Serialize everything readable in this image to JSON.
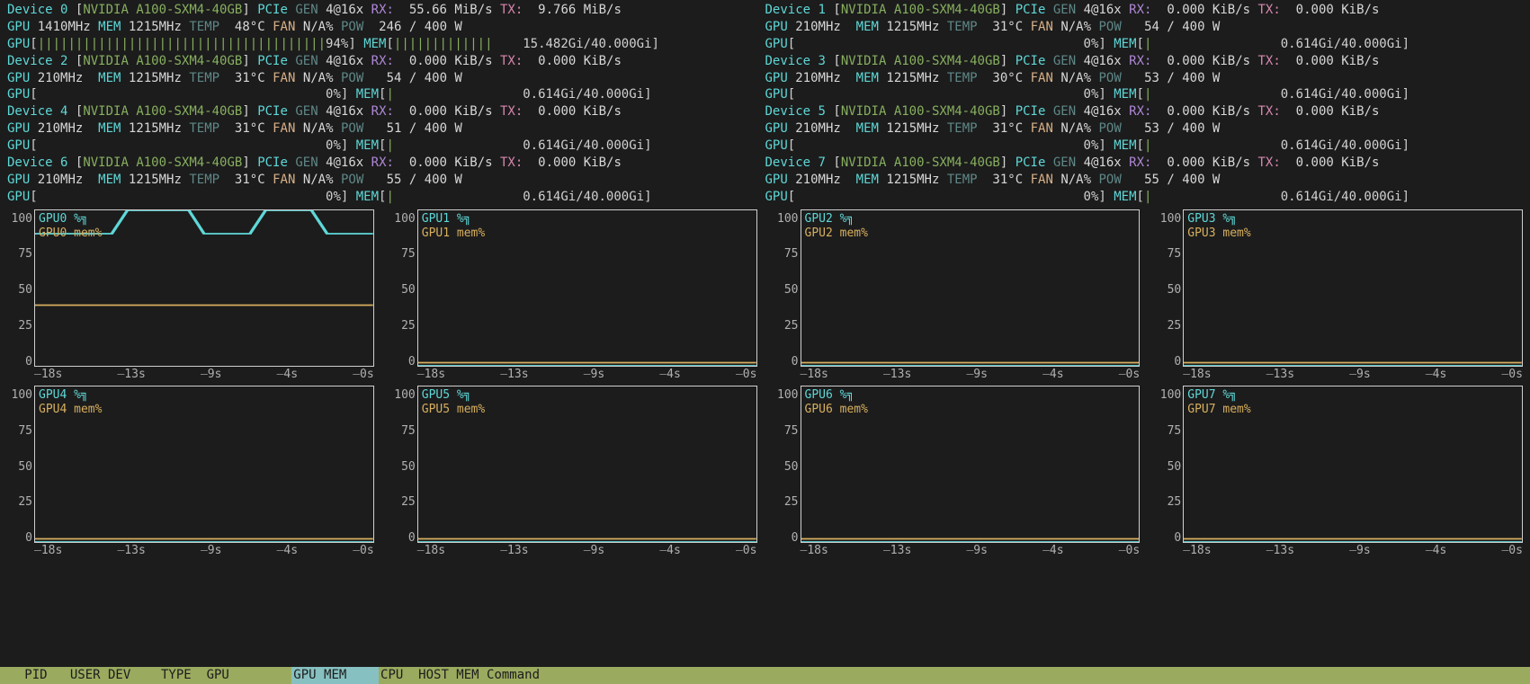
{
  "devices": [
    {
      "idx": 0,
      "model": "NVIDIA A100-SXM4-40GB",
      "pcie_gen": "4@16x",
      "rx": "55.66 MiB/s",
      "tx": "9.766 MiB/s",
      "gpu_clk": "1410MHz",
      "mem_clk": "1215MHz",
      "temp": "48°C",
      "fan": "N/A%",
      "pow": "246 / 400 W",
      "gpu_util": 94,
      "mem_used": "15.482Gi",
      "mem_total": "40.000Gi",
      "mem_pct": 39
    },
    {
      "idx": 1,
      "model": "NVIDIA A100-SXM4-40GB",
      "pcie_gen": "4@16x",
      "rx": "0.000 KiB/s",
      "tx": "0.000 KiB/s",
      "gpu_clk": "210MHz",
      "mem_clk": "1215MHz",
      "temp": "31°C",
      "fan": "N/A%",
      "pow": "54 / 400 W",
      "gpu_util": 0,
      "mem_used": "0.614Gi",
      "mem_total": "40.000Gi",
      "mem_pct": 2
    },
    {
      "idx": 2,
      "model": "NVIDIA A100-SXM4-40GB",
      "pcie_gen": "4@16x",
      "rx": "0.000 KiB/s",
      "tx": "0.000 KiB/s",
      "gpu_clk": "210MHz",
      "mem_clk": "1215MHz",
      "temp": "31°C",
      "fan": "N/A%",
      "pow": "54 / 400 W",
      "gpu_util": 0,
      "mem_used": "0.614Gi",
      "mem_total": "40.000Gi",
      "mem_pct": 2
    },
    {
      "idx": 3,
      "model": "NVIDIA A100-SXM4-40GB",
      "pcie_gen": "4@16x",
      "rx": "0.000 KiB/s",
      "tx": "0.000 KiB/s",
      "gpu_clk": "210MHz",
      "mem_clk": "1215MHz",
      "temp": "30°C",
      "fan": "N/A%",
      "pow": "53 / 400 W",
      "gpu_util": 0,
      "mem_used": "0.614Gi",
      "mem_total": "40.000Gi",
      "mem_pct": 2
    },
    {
      "idx": 4,
      "model": "NVIDIA A100-SXM4-40GB",
      "pcie_gen": "4@16x",
      "rx": "0.000 KiB/s",
      "tx": "0.000 KiB/s",
      "gpu_clk": "210MHz",
      "mem_clk": "1215MHz",
      "temp": "31°C",
      "fan": "N/A%",
      "pow": "51 / 400 W",
      "gpu_util": 0,
      "mem_used": "0.614Gi",
      "mem_total": "40.000Gi",
      "mem_pct": 2
    },
    {
      "idx": 5,
      "model": "NVIDIA A100-SXM4-40GB",
      "pcie_gen": "4@16x",
      "rx": "0.000 KiB/s",
      "tx": "0.000 KiB/s",
      "gpu_clk": "210MHz",
      "mem_clk": "1215MHz",
      "temp": "31°C",
      "fan": "N/A%",
      "pow": "53 / 400 W",
      "gpu_util": 0,
      "mem_used": "0.614Gi",
      "mem_total": "40.000Gi",
      "mem_pct": 2
    },
    {
      "idx": 6,
      "model": "NVIDIA A100-SXM4-40GB",
      "pcie_gen": "4@16x",
      "rx": "0.000 KiB/s",
      "tx": "0.000 KiB/s",
      "gpu_clk": "210MHz",
      "mem_clk": "1215MHz",
      "temp": "31°C",
      "fan": "N/A%",
      "pow": "55 / 400 W",
      "gpu_util": 0,
      "mem_used": "0.614Gi",
      "mem_total": "40.000Gi",
      "mem_pct": 2
    },
    {
      "idx": 7,
      "model": "NVIDIA A100-SXM4-40GB",
      "pcie_gen": "4@16x",
      "rx": "0.000 KiB/s",
      "tx": "0.000 KiB/s",
      "gpu_clk": "210MHz",
      "mem_clk": "1215MHz",
      "temp": "31°C",
      "fan": "N/A%",
      "pow": "55 / 400 W",
      "gpu_util": 0,
      "mem_used": "0.614Gi",
      "mem_total": "40.000Gi",
      "mem_pct": 2
    }
  ],
  "labels": {
    "device": "Device",
    "pcie": "PCIe",
    "gen": "GEN",
    "rx": "RX:",
    "tx": "TX:",
    "gpu": "GPU",
    "mem": "MEM",
    "temp": "TEMP",
    "fan": "FAN",
    "pow": "POW"
  },
  "chart_axes": {
    "y": [
      "100",
      "75",
      "50",
      "25",
      "0"
    ],
    "x": [
      "18s",
      "13s",
      "9s",
      "4s",
      "0s"
    ]
  },
  "chart_data": [
    {
      "name": "GPU0",
      "legend_util": "GPU0 %",
      "legend_mem": "GPU0 mem%",
      "util_series": [
        85,
        85,
        85,
        85,
        85,
        85,
        100,
        100,
        100,
        100,
        100,
        85,
        85,
        85,
        85,
        100,
        100,
        100,
        100,
        85,
        85,
        85,
        85
      ],
      "mem_series": [
        39,
        39,
        39,
        39,
        39,
        39,
        39,
        39,
        39,
        39,
        39,
        39,
        39,
        39,
        39,
        39,
        39,
        39,
        39,
        39,
        39,
        39,
        39
      ]
    },
    {
      "name": "GPU1",
      "legend_util": "GPU1 %",
      "legend_mem": "GPU1 mem%",
      "util_series": [
        0,
        0,
        0,
        0,
        0,
        0,
        0,
        0,
        0,
        0,
        0,
        0,
        0,
        0,
        0,
        0,
        0,
        0,
        0,
        0,
        0,
        0,
        0
      ],
      "mem_series": [
        2,
        2,
        2,
        2,
        2,
        2,
        2,
        2,
        2,
        2,
        2,
        2,
        2,
        2,
        2,
        2,
        2,
        2,
        2,
        2,
        2,
        2,
        2
      ]
    },
    {
      "name": "GPU2",
      "legend_util": "GPU2 %",
      "legend_mem": "GPU2 mem%",
      "util_series": [
        0,
        0,
        0,
        0,
        0,
        0,
        0,
        0,
        0,
        0,
        0,
        0,
        0,
        0,
        0,
        0,
        0,
        0,
        0,
        0,
        0,
        0,
        0
      ],
      "mem_series": [
        2,
        2,
        2,
        2,
        2,
        2,
        2,
        2,
        2,
        2,
        2,
        2,
        2,
        2,
        2,
        2,
        2,
        2,
        2,
        2,
        2,
        2,
        2
      ]
    },
    {
      "name": "GPU3",
      "legend_util": "GPU3 %",
      "legend_mem": "GPU3 mem%",
      "util_series": [
        0,
        0,
        0,
        0,
        0,
        0,
        0,
        0,
        0,
        0,
        0,
        0,
        0,
        0,
        0,
        0,
        0,
        0,
        0,
        0,
        0,
        0,
        0
      ],
      "mem_series": [
        2,
        2,
        2,
        2,
        2,
        2,
        2,
        2,
        2,
        2,
        2,
        2,
        2,
        2,
        2,
        2,
        2,
        2,
        2,
        2,
        2,
        2,
        2
      ]
    },
    {
      "name": "GPU4",
      "legend_util": "GPU4 %",
      "legend_mem": "GPU4 mem%",
      "util_series": [
        0,
        0,
        0,
        0,
        0,
        0,
        0,
        0,
        0,
        0,
        0,
        0,
        0,
        0,
        0,
        0,
        0,
        0,
        0,
        0,
        0,
        0,
        0
      ],
      "mem_series": [
        2,
        2,
        2,
        2,
        2,
        2,
        2,
        2,
        2,
        2,
        2,
        2,
        2,
        2,
        2,
        2,
        2,
        2,
        2,
        2,
        2,
        2,
        2
      ]
    },
    {
      "name": "GPU5",
      "legend_util": "GPU5 %",
      "legend_mem": "GPU5 mem%",
      "util_series": [
        0,
        0,
        0,
        0,
        0,
        0,
        0,
        0,
        0,
        0,
        0,
        0,
        0,
        0,
        0,
        0,
        0,
        0,
        0,
        0,
        0,
        0,
        0
      ],
      "mem_series": [
        2,
        2,
        2,
        2,
        2,
        2,
        2,
        2,
        2,
        2,
        2,
        2,
        2,
        2,
        2,
        2,
        2,
        2,
        2,
        2,
        2,
        2,
        2
      ]
    },
    {
      "name": "GPU6",
      "legend_util": "GPU6 %",
      "legend_mem": "GPU6 mem%",
      "util_series": [
        0,
        0,
        0,
        0,
        0,
        0,
        0,
        0,
        0,
        0,
        0,
        0,
        0,
        0,
        0,
        0,
        0,
        0,
        0,
        0,
        0,
        0,
        0
      ],
      "mem_series": [
        2,
        2,
        2,
        2,
        2,
        2,
        2,
        2,
        2,
        2,
        2,
        2,
        2,
        2,
        2,
        2,
        2,
        2,
        2,
        2,
        2,
        2,
        2
      ]
    },
    {
      "name": "GPU7",
      "legend_util": "GPU7 %",
      "legend_mem": "GPU7 mem%",
      "util_series": [
        0,
        0,
        0,
        0,
        0,
        0,
        0,
        0,
        0,
        0,
        0,
        0,
        0,
        0,
        0,
        0,
        0,
        0,
        0,
        0,
        0,
        0,
        0
      ],
      "mem_series": [
        2,
        2,
        2,
        2,
        2,
        2,
        2,
        2,
        2,
        2,
        2,
        2,
        2,
        2,
        2,
        2,
        2,
        2,
        2,
        2,
        2,
        2,
        2
      ]
    }
  ],
  "footer": {
    "a": "   PID   USER DEV    TYPE  GPU        ",
    "b": "GPU MEM    ",
    "c": "CPU  HOST MEM Command   "
  },
  "colors": {
    "util": "#5fd7d7",
    "mem": "#d7af5f",
    "bar": "#87af5f"
  }
}
